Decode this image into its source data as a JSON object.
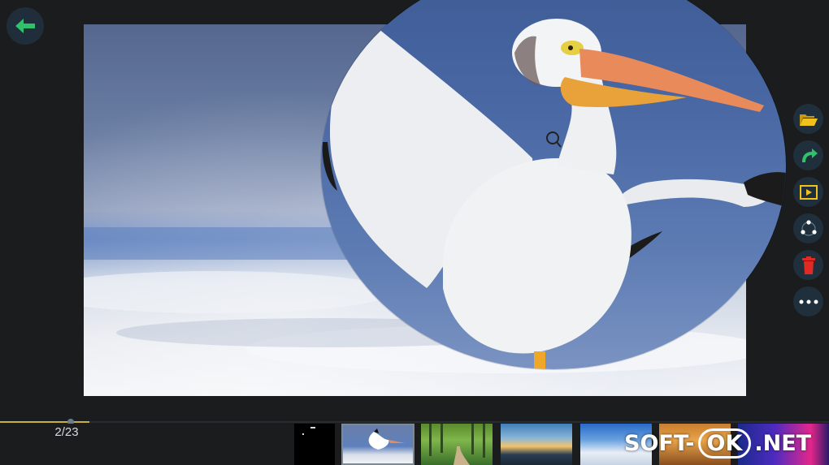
{
  "viewer": {
    "counter": "2/23",
    "progress_fraction": 0.108
  },
  "toolbar": {
    "back": {
      "icon": "arrow-left-icon"
    },
    "side_buttons": [
      {
        "name": "open-folder-button",
        "icon": "folder-open-icon"
      },
      {
        "name": "rotate-button",
        "icon": "rotate-right-icon"
      },
      {
        "name": "slideshow-button",
        "icon": "play-slideshow-icon"
      },
      {
        "name": "share-button",
        "icon": "share-icon"
      },
      {
        "name": "delete-button",
        "icon": "trash-icon"
      },
      {
        "name": "more-button",
        "icon": "more-dots-icon"
      }
    ]
  },
  "colors": {
    "accent_green": "#2fc26b",
    "accent_yellow": "#f1c21b",
    "delete_red": "#e02a24",
    "button_bg": "#1f2f3b"
  },
  "filmstrip": {
    "selected_index": 1,
    "thumbnails": [
      "dark",
      "pelican",
      "forest-path",
      "sunset-sea",
      "winter-lake",
      "autumn-canyon",
      "neon-abstract"
    ]
  },
  "watermark": {
    "left": "SOFT-",
    "mid": "OK",
    "right": ".NET"
  }
}
